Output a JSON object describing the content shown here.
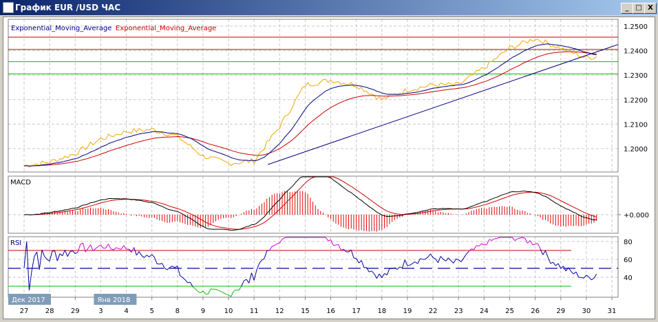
{
  "window": {
    "title": "График EUR /USD  ЧАС",
    "buttons": {
      "minimize": "_",
      "maximize": "□",
      "close": "X"
    }
  },
  "legend": {
    "ema1": "Exponential_Moving_Average",
    "ema2": "Exponential_Moving_Average"
  },
  "panels": {
    "macd_label": "MACD",
    "rsi_label": "RSI"
  },
  "colors": {
    "price": "#f0a800",
    "ema_fast": "#000080",
    "ema_slow": "#cc0000",
    "resistance": "#c00000",
    "support": "#00c000",
    "rsi": "#0000a0",
    "rsi_overbought": "#d000d0",
    "rsi_oversold": "#00c000"
  },
  "chart_data": [
    {
      "type": "line",
      "title": "EUR/USD H1",
      "ylim": [
        1.1935,
        1.253
      ],
      "y_ticks": [
        "1.2000",
        "1.2100",
        "1.2200",
        "1.2300",
        "1.2400",
        "1.2500"
      ],
      "x_labels": [
        "27",
        "28",
        "29",
        "3",
        "4",
        "5",
        "8",
        "9",
        "10",
        "11",
        "12",
        "15",
        "16",
        "17",
        "18",
        "19",
        "22",
        "23",
        "24",
        "25",
        "26",
        "29",
        "30",
        "31"
      ],
      "month_labels": [
        {
          "text": "Дек 2017",
          "at": "27"
        },
        {
          "text": "Янв 2018",
          "at": "3"
        }
      ],
      "close": [
        1.193,
        1.1945,
        1.198,
        1.204,
        1.207,
        1.2078,
        1.205,
        1.197,
        1.194,
        1.195,
        1.209,
        1.226,
        1.228,
        1.226,
        1.22,
        1.224,
        1.226,
        1.226,
        1.233,
        1.241,
        1.245,
        1.241,
        1.237,
        1.2385
      ],
      "hlines": {
        "red": [
          1.2455,
          1.2405
        ],
        "green": [
          1.2355,
          1.2305
        ]
      },
      "trendline": {
        "from": [
          "11",
          1.1935
        ],
        "to": [
          "31",
          1.2425
        ]
      }
    },
    {
      "type": "line",
      "title": "MACD",
      "y_ticks": [
        "+0.000"
      ]
    },
    {
      "type": "line",
      "title": "RSI",
      "y_ticks": [
        "80",
        "60",
        "40"
      ],
      "levels": [
        70,
        50,
        30
      ],
      "ylim": [
        20,
        85
      ]
    }
  ]
}
